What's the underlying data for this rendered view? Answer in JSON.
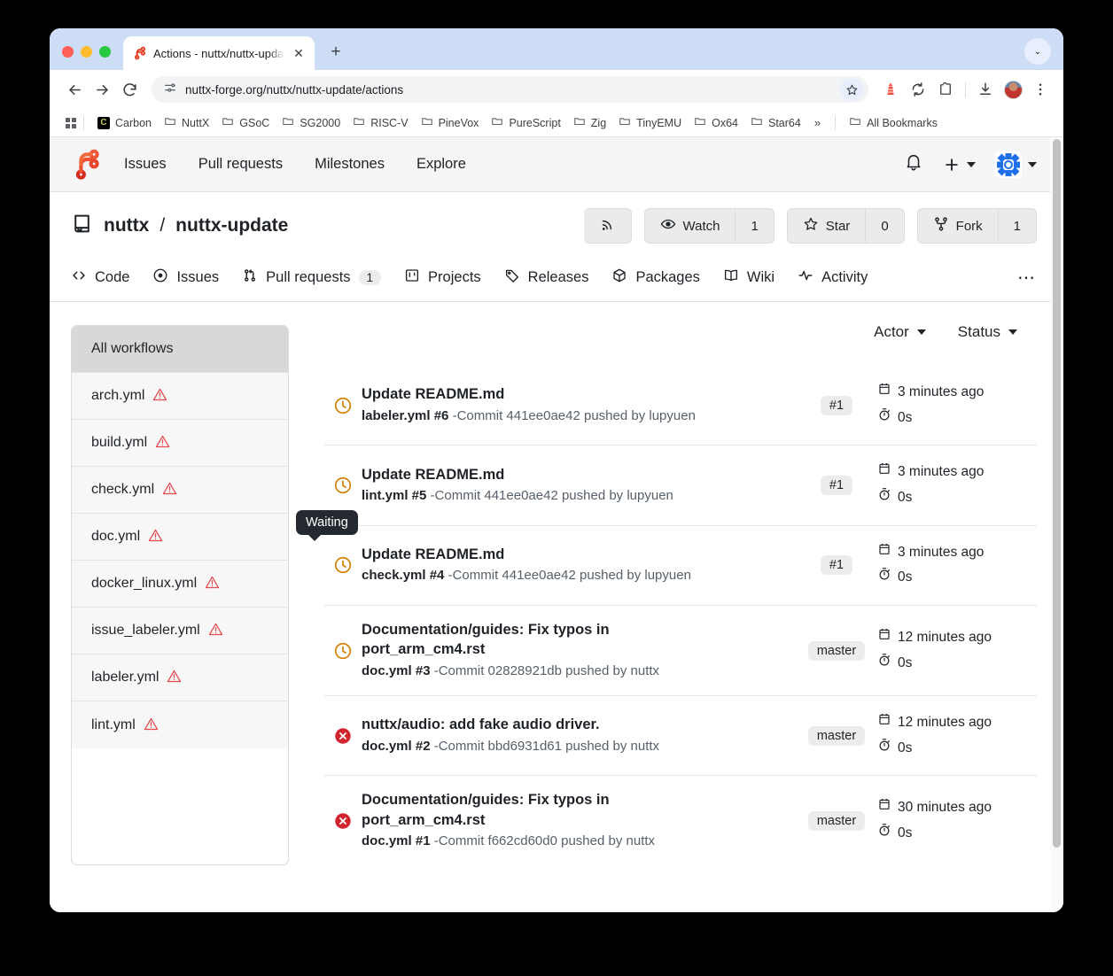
{
  "browser": {
    "tab": {
      "title": "Actions - nuttx/nuttx-update -",
      "favicon": "forgejo-icon",
      "close": "✕"
    },
    "new_tab_label": "+",
    "tab_list_chevron": "⌄",
    "nav": {
      "back": "←",
      "forward": "→",
      "reload": "↻"
    },
    "omnibox": {
      "site_info_icon": "tune-icon",
      "url": "nuttx-forge.org/nuttx/nuttx-update/actions",
      "star_icon": "☆"
    },
    "toolbar_icons": [
      "lighthouse-extension-icon",
      "sync-icon",
      "extensions-icon",
      "download-icon",
      "profile-avatar",
      "chrome-menu-icon"
    ],
    "bookmarks": [
      {
        "label": "Carbon",
        "icon": "carbon-favicon"
      },
      {
        "label": "NuttX",
        "icon": "folder-icon"
      },
      {
        "label": "GSoC",
        "icon": "folder-icon"
      },
      {
        "label": "SG2000",
        "icon": "folder-icon"
      },
      {
        "label": "RISC-V",
        "icon": "folder-icon"
      },
      {
        "label": "PineVox",
        "icon": "folder-icon"
      },
      {
        "label": "PureScript",
        "icon": "folder-icon"
      },
      {
        "label": "Zig",
        "icon": "folder-icon"
      },
      {
        "label": "TinyEMU",
        "icon": "folder-icon"
      },
      {
        "label": "Ox64",
        "icon": "folder-icon"
      },
      {
        "label": "Star64",
        "icon": "folder-icon"
      }
    ],
    "bookmarks_overflow": "»",
    "all_bookmarks": {
      "label": "All Bookmarks",
      "icon": "folder-icon"
    }
  },
  "site": {
    "nav_links": [
      "Issues",
      "Pull requests",
      "Milestones",
      "Explore"
    ],
    "bell_icon": "bell-icon",
    "plus_label": "+",
    "avatar_icon": "user-avatar"
  },
  "repo": {
    "owner": "nuttx",
    "separator": "/",
    "name": "nuttx-update",
    "icon": "repo-icon",
    "actions": {
      "rss": {
        "icon": "rss-icon"
      },
      "watch": {
        "label": "Watch",
        "count": "1",
        "icon": "eye-icon"
      },
      "star": {
        "label": "Star",
        "count": "0",
        "icon": "star-icon"
      },
      "fork": {
        "label": "Fork",
        "count": "1",
        "icon": "fork-icon"
      }
    },
    "tabs": [
      {
        "label": "Code",
        "icon": "code-icon",
        "count": null
      },
      {
        "label": "Issues",
        "icon": "issue-opened-icon",
        "count": null
      },
      {
        "label": "Pull requests",
        "icon": "git-pull-request-icon",
        "count": "1"
      },
      {
        "label": "Projects",
        "icon": "project-icon",
        "count": null
      },
      {
        "label": "Releases",
        "icon": "tag-icon",
        "count": null
      },
      {
        "label": "Packages",
        "icon": "package-icon",
        "count": null
      },
      {
        "label": "Wiki",
        "icon": "book-icon",
        "count": null
      },
      {
        "label": "Activity",
        "icon": "pulse-icon",
        "count": null
      }
    ],
    "tabs_more": "⋯"
  },
  "workflows": {
    "all_label": "All workflows",
    "items": [
      {
        "label": "arch.yml",
        "warning": "⚠"
      },
      {
        "label": "build.yml",
        "warning": "⚠"
      },
      {
        "label": "check.yml",
        "warning": "⚠"
      },
      {
        "label": "doc.yml",
        "warning": "⚠"
      },
      {
        "label": "docker_linux.yml",
        "warning": "⚠"
      },
      {
        "label": "issue_labeler.yml",
        "warning": "⚠"
      },
      {
        "label": "labeler.yml",
        "warning": "⚠"
      },
      {
        "label": "lint.yml",
        "warning": "⚠"
      }
    ]
  },
  "filters": {
    "actor": "Actor",
    "status": "Status",
    "caret": "▾"
  },
  "tooltip": {
    "text": "Waiting"
  },
  "runs": [
    {
      "status": "waiting",
      "title": "Update README.md",
      "workflow": "labeler.yml #6",
      "detail": "-Commit 441ee0ae42 pushed by lupyuen",
      "branch": "#1",
      "time": "3 minutes ago",
      "duration": "0s"
    },
    {
      "status": "waiting",
      "title": "Update README.md",
      "workflow": "lint.yml #5",
      "detail": "-Commit 441ee0ae42 pushed by lupyuen",
      "branch": "#1",
      "time": "3 minutes ago",
      "duration": "0s"
    },
    {
      "status": "waiting",
      "title": "Update README.md",
      "workflow": "check.yml #4",
      "detail": "-Commit 441ee0ae42 pushed by lupyuen",
      "branch": "#1",
      "time": "3 minutes ago",
      "duration": "0s"
    },
    {
      "status": "waiting",
      "title": "Documentation/guides: Fix typos in port_arm_cm4.rst",
      "workflow": "doc.yml #3",
      "detail": "-Commit 02828921db pushed by nuttx",
      "branch": "master",
      "time": "12 minutes ago",
      "duration": "0s"
    },
    {
      "status": "failure",
      "title": "nuttx/audio: add fake audio driver.",
      "workflow": "doc.yml #2",
      "detail": "-Commit bbd6931d61 pushed by nuttx",
      "branch": "master",
      "time": "12 minutes ago",
      "duration": "0s"
    },
    {
      "status": "failure",
      "title": "Documentation/guides: Fix typos in port_arm_cm4.rst",
      "workflow": "doc.yml #1",
      "detail": "-Commit f662cd60d0 pushed by nuttx",
      "branch": "master",
      "time": "30 minutes ago",
      "duration": "0s"
    }
  ],
  "colors": {
    "waiting": "#d4820a",
    "failure": "#d1242f",
    "warning": "#e5484d",
    "tab_strip": "#ccddf5",
    "forgejo_red": "#e8442e"
  }
}
